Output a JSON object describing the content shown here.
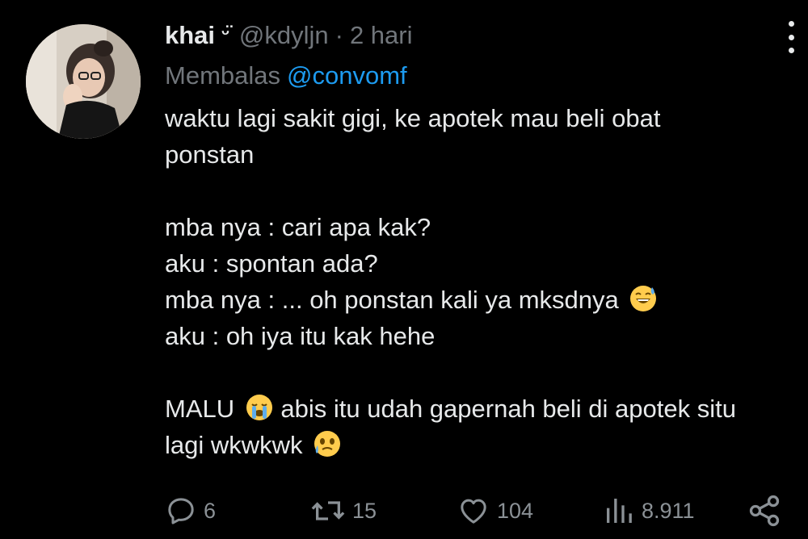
{
  "tweet": {
    "author_name": "khai",
    "author_emoji": "ᵕ̈",
    "handle": "@kdyljn",
    "separator": "·",
    "time": "2 hari",
    "reply_prefix": "Membalas",
    "reply_to": "@convomf",
    "lines": {
      "l1": "waktu lagi sakit gigi, ke apotek mau beli obat",
      "l2": "ponstan",
      "l3": "mba nya : cari apa kak?",
      "l4": "aku : spontan ada?",
      "l5": "mba nya : ... oh ponstan kali ya mksdnya",
      "l6": "aku : oh iya itu kak hehe",
      "l7a": "MALU",
      "l7b": "abis itu udah gapernah beli di apotek situ",
      "l8": "lagi wkwkwk"
    },
    "emojis": {
      "e1": "grinning-face-with-sweat-emoji",
      "e2": "loudly-crying-face-emoji",
      "e3": "face-holding-back-tears-emoji"
    }
  },
  "actions": {
    "replies": "6",
    "retweets": "15",
    "likes": "104",
    "views": "8.911"
  },
  "colors": {
    "background": "#000000",
    "text": "#e7e9ea",
    "secondary": "#71767b",
    "link": "#1d9bf0"
  }
}
